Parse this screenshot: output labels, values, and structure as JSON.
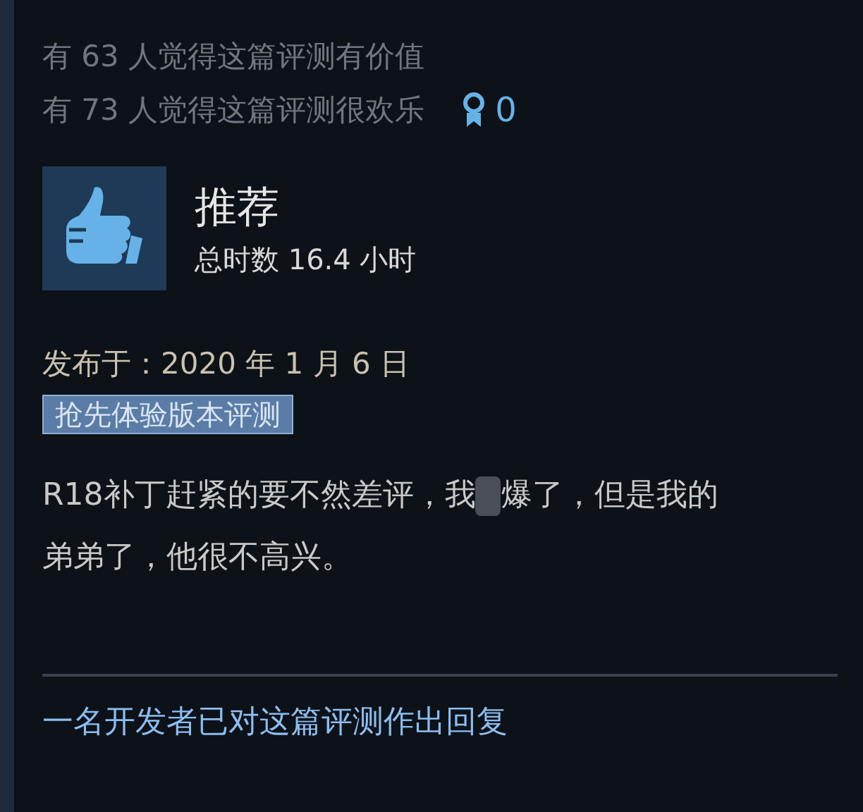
{
  "stats": {
    "helpful": "有 63 人觉得这篇评测有价值",
    "funny": "有 73 人觉得这篇评测很欢乐",
    "awards": "0"
  },
  "verdict": {
    "kind": "recommended",
    "label": "推荐",
    "hours": "总时数 16.4 小时"
  },
  "posted": "发布于：2020 年 1 月 6 日",
  "tag": "抢先体验版本评测",
  "review": {
    "before_redaction": "R18补丁赶紧的要不然差评，我",
    "redacted": true,
    "after_redaction": "爆了，但是我的弟弟了，他很不高兴。"
  },
  "developer_reply_link": "一名开发者已对这篇评测作出回复"
}
